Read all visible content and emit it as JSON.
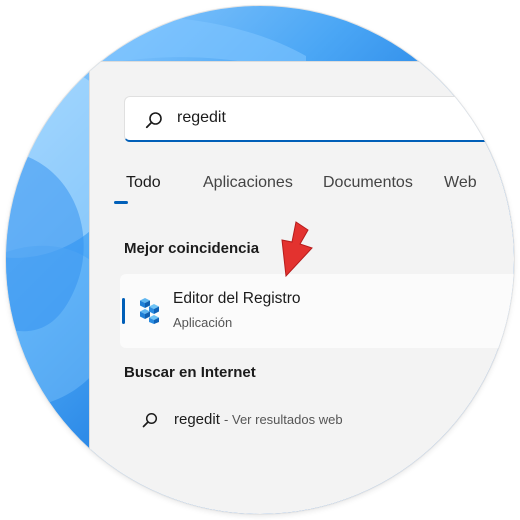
{
  "search": {
    "query": "regedit"
  },
  "tabs": [
    {
      "label": "Todo",
      "active": true
    },
    {
      "label": "Aplicaciones",
      "active": false
    },
    {
      "label": "Documentos",
      "active": false
    },
    {
      "label": "Web",
      "active": false
    }
  ],
  "best_match": {
    "heading": "Mejor coincidencia",
    "title": "Editor del Registro",
    "subtitle": "Aplicación",
    "icon": "registry-editor-icon"
  },
  "web_search": {
    "heading": "Buscar en Internet",
    "query": "regedit",
    "hint": "- Ver resultados web",
    "icon": "search-icon"
  },
  "colors": {
    "accent": "#005fb8",
    "arrow": "#e3322f"
  }
}
